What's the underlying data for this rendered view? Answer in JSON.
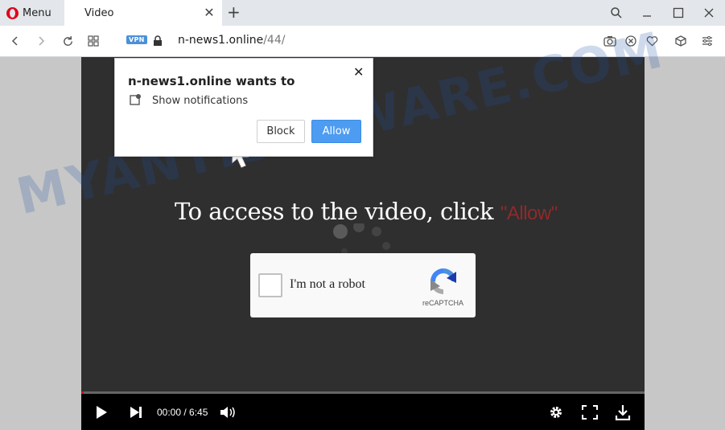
{
  "browser": {
    "menu_label": "Menu",
    "tab_title": "Video",
    "vpn_label": "VPN",
    "url_domain": "n-news1.online",
    "url_path": "/44/"
  },
  "notification": {
    "title": "n-news1.online wants to",
    "permission": "Show notifications",
    "block_label": "Block",
    "allow_label": "Allow"
  },
  "page": {
    "access_text": "To access to the video, click",
    "allow_word": "\"Allow\"",
    "captcha_label": "I'm not a robot",
    "captcha_brand": "reCAPTCHA",
    "watermark": "MYANTISPYWARE.COM"
  },
  "player": {
    "time": "00:00 / 6:45",
    "progress": 0.0
  },
  "colors": {
    "allow_button": "#4d9cf2",
    "allow_word": "#8e2a2a",
    "opera_red": "#e0001a",
    "progress_red": "#ee0000"
  }
}
